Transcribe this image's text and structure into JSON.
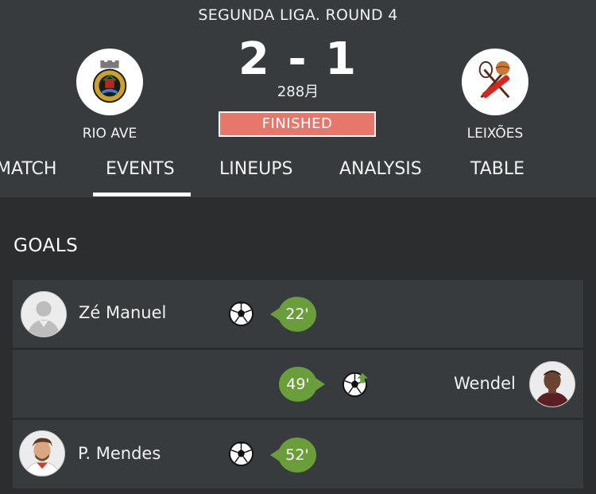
{
  "header": {
    "round_title": "SEGUNDA LIGA. ROUND 4",
    "score": "2 - 1",
    "attendance": "288月",
    "status": "FINISHED",
    "status_color": "#e8776b",
    "home_team": {
      "name": "RIO AVE",
      "logo": "rio-ave-crest-icon"
    },
    "away_team": {
      "name": "LEIXÕES",
      "logo": "leixoes-crest-icon"
    }
  },
  "tabs": [
    {
      "label": "MATCH"
    },
    {
      "label": "EVENTS",
      "active": true
    },
    {
      "label": "LINEUPS"
    },
    {
      "label": "ANALYSIS"
    },
    {
      "label": "TABLE"
    }
  ],
  "goals_section": {
    "title": "GOALS",
    "accent_color": "#6a9e3a",
    "goals": [
      {
        "player": "Zé Manuel",
        "minute": "22'",
        "side": "home",
        "icon": "soccer-ball-icon"
      },
      {
        "player": "Wendel",
        "minute": "49'",
        "side": "away",
        "icon": "own-goal-ball-icon"
      },
      {
        "player": "P. Mendes",
        "minute": "52'",
        "side": "home",
        "icon": "soccer-ball-icon"
      }
    ]
  }
}
